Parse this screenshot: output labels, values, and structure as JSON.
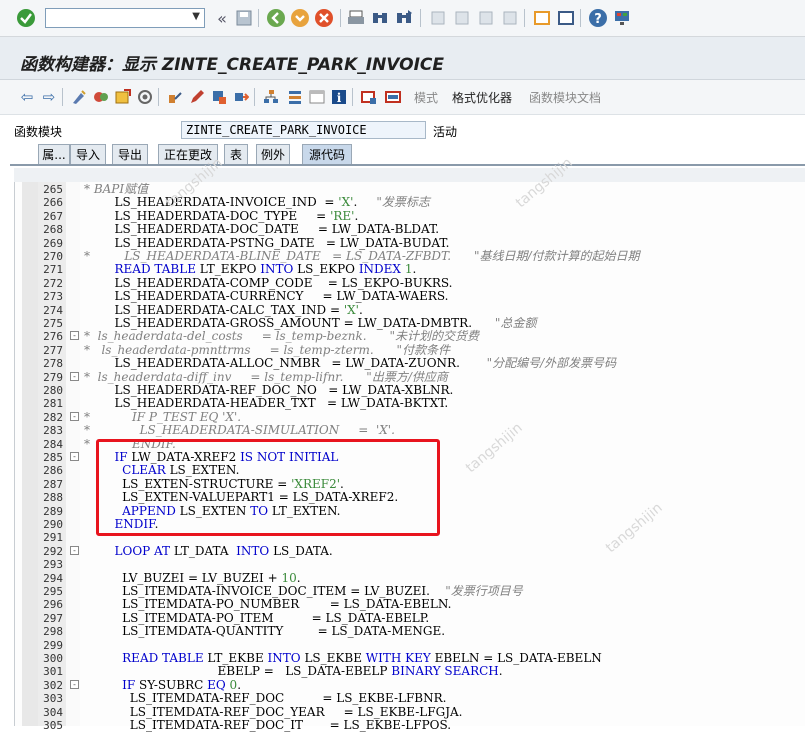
{
  "window": {
    "title": "函数构建器：显示 ZINTE_CREATE_PARK_INVOICE"
  },
  "toolbar2": {
    "mode_label": "模式",
    "pretty_printer_label": "格式优化器",
    "module_doc_label": "函数模块文档"
  },
  "function_module": {
    "label": "函数模块",
    "value": "ZINTE_CREATE_PARK_INVOICE",
    "status": "活动"
  },
  "tabs": [
    {
      "label": "属..."
    },
    {
      "label": "导入"
    },
    {
      "label": "导出"
    },
    {
      "label": "正在更改"
    },
    {
      "label": "表"
    },
    {
      "label": "例外"
    },
    {
      "label": "源代码"
    }
  ],
  "watermark": "tangshijin",
  "code_lines": [
    {
      "n": "265",
      "segs": [
        [
          "cm",
          "* BAPI赋值"
        ]
      ]
    },
    {
      "n": "266",
      "segs": [
        [
          "",
          "        LS_HEADERDATA-INVOICE_IND  = "
        ],
        [
          "str",
          "'X'"
        ],
        [
          "",
          "."
        ],
        [
          "cm",
          "     \"发票标志"
        ]
      ]
    },
    {
      "n": "267",
      "segs": [
        [
          "",
          "        LS_HEADERDATA-DOC_TYPE     = "
        ],
        [
          "str",
          "'RE'"
        ],
        [
          "",
          "."
        ]
      ]
    },
    {
      "n": "268",
      "segs": [
        [
          "",
          "        LS_HEADERDATA-DOC_DATE     = LW_DATA-BLDAT."
        ]
      ]
    },
    {
      "n": "269",
      "segs": [
        [
          "",
          "        LS_HEADERDATA-PSTNG_DATE   = LW_DATA-BUDAT."
        ]
      ]
    },
    {
      "n": "270",
      "segs": [
        [
          "cm",
          "*         LS_HEADERDATA-BLINE_DATE   = LS_DATA-ZFBDT.      \"基线日期/付款计算的起始日期"
        ]
      ]
    },
    {
      "n": "271",
      "segs": [
        [
          "kw",
          "        READ TABLE"
        ],
        [
          "",
          " LT_EKPO "
        ],
        [
          "kw",
          "INTO"
        ],
        [
          "",
          " LS_EKPO "
        ],
        [
          "kw",
          "INDEX"
        ],
        [
          "",
          " "
        ],
        [
          "num",
          "1"
        ],
        [
          "",
          "."
        ]
      ]
    },
    {
      "n": "272",
      "segs": [
        [
          "",
          "        LS_HEADERDATA-COMP_CODE    = LS_EKPO-BUKRS."
        ]
      ]
    },
    {
      "n": "273",
      "segs": [
        [
          "",
          "        LS_HEADERDATA-CURRENCY     = LW_DATA-WAERS."
        ]
      ]
    },
    {
      "n": "274",
      "segs": [
        [
          "",
          "        LS_HEADERDATA-CALC_TAX_IND = "
        ],
        [
          "str",
          "'X'"
        ],
        [
          "",
          "."
        ]
      ]
    },
    {
      "n": "275",
      "segs": [
        [
          "",
          "        LS_HEADERDATA-GROSS_AMOUNT = LW_DATA-DMBTR."
        ],
        [
          "cm",
          "      \"总金额"
        ]
      ]
    },
    {
      "n": "276",
      "fold": "-",
      "segs": [
        [
          "cm",
          "*  ls_headerdata-del_costs     = ls_temp-beznk.      \"未计划的交货费"
        ]
      ]
    },
    {
      "n": "277",
      "segs": [
        [
          "cm",
          "*   ls_headerdata-pmnttrms     = ls_temp-zterm.      \"付款条件"
        ]
      ]
    },
    {
      "n": "278",
      "segs": [
        [
          "",
          "        LS_HEADERDATA-ALLOC_NMBR   = LW_DATA-ZUONR."
        ],
        [
          "cm",
          "       \"分配编号/外部发票号码"
        ]
      ]
    },
    {
      "n": "279",
      "fold": "-",
      "segs": [
        [
          "cm",
          "*  ls_headerdata-diff_inv     = ls_temp-lifnr.      \"出票方/供应商"
        ]
      ]
    },
    {
      "n": "280",
      "segs": [
        [
          "",
          "        LS_HEADERDATA-REF_DOC_NO   = LW_DATA-XBLNR."
        ]
      ]
    },
    {
      "n": "281",
      "segs": [
        [
          "",
          "        LS_HEADERDATA-HEADER_TXT   = LW_DATA-BKTXT."
        ]
      ]
    },
    {
      "n": "282",
      "fold": "-",
      "segs": [
        [
          "cm",
          "*           IF P_TEST EQ 'X'."
        ]
      ]
    },
    {
      "n": "283",
      "segs": [
        [
          "cm",
          "*             LS_HEADERDATA-SIMULATION     =  'X'."
        ]
      ]
    },
    {
      "n": "284",
      "segs": [
        [
          "cm",
          "*           ENDIF."
        ]
      ]
    },
    {
      "n": "285",
      "fold": "-",
      "segs": [
        [
          "kw",
          "        IF"
        ],
        [
          "",
          " LW_DATA-XREF2 "
        ],
        [
          "kw",
          "IS NOT INITIAL"
        ],
        [
          "",
          ""
        ]
      ]
    },
    {
      "n": "286",
      "segs": [
        [
          "kw",
          "          CLEAR"
        ],
        [
          "",
          " LS_EXTEN."
        ]
      ]
    },
    {
      "n": "287",
      "segs": [
        [
          "",
          "          LS_EXTEN-STRUCTURE = "
        ],
        [
          "str",
          "'XREF2'"
        ],
        [
          "",
          "."
        ]
      ]
    },
    {
      "n": "288",
      "segs": [
        [
          "",
          "          LS_EXTEN-VALUEPART1 = LS_DATA-XREF2."
        ]
      ]
    },
    {
      "n": "289",
      "segs": [
        [
          "kw",
          "          APPEND"
        ],
        [
          "",
          " LS_EXTEN "
        ],
        [
          "kw",
          "TO"
        ],
        [
          "",
          " LT_EXTEN."
        ]
      ]
    },
    {
      "n": "290",
      "segs": [
        [
          "kw",
          "        ENDIF"
        ],
        [
          "",
          "."
        ]
      ]
    },
    {
      "n": "291",
      "segs": [
        [
          "",
          ""
        ]
      ]
    },
    {
      "n": "292",
      "fold": "-",
      "segs": [
        [
          "kw",
          "        LOOP AT"
        ],
        [
          "",
          " LT_DATA  "
        ],
        [
          "kw",
          "INTO"
        ],
        [
          "",
          " LS_DATA."
        ]
      ]
    },
    {
      "n": "293",
      "segs": [
        [
          "",
          ""
        ]
      ]
    },
    {
      "n": "294",
      "segs": [
        [
          "",
          "          LV_BUZEI = LV_BUZEI + "
        ],
        [
          "num",
          "10"
        ],
        [
          "",
          "."
        ]
      ]
    },
    {
      "n": "295",
      "segs": [
        [
          "",
          "          LS_ITEMDATA-INVOICE_DOC_ITEM = LV_BUZEI."
        ],
        [
          "cm",
          "    \"发票行项目号"
        ]
      ]
    },
    {
      "n": "296",
      "segs": [
        [
          "",
          "          LS_ITEMDATA-PO_NUMBER        = LS_DATA-EBELN."
        ]
      ]
    },
    {
      "n": "297",
      "segs": [
        [
          "",
          "          LS_ITEMDATA-PO_ITEM          = LS_DATA-EBELP."
        ]
      ]
    },
    {
      "n": "298",
      "segs": [
        [
          "",
          "          LS_ITEMDATA-QUANTITY         = LS_DATA-MENGE."
        ]
      ]
    },
    {
      "n": "299",
      "segs": [
        [
          "",
          ""
        ]
      ]
    },
    {
      "n": "300",
      "segs": [
        [
          "kw",
          "          READ TABLE"
        ],
        [
          "",
          " LT_EKBE "
        ],
        [
          "kw",
          "INTO"
        ],
        [
          "",
          " LS_EKBE "
        ],
        [
          "kw",
          "WITH KEY"
        ],
        [
          "",
          " EBELN = LS_DATA-EBELN"
        ]
      ]
    },
    {
      "n": "301",
      "segs": [
        [
          "",
          "                                   EBELP =   LS_DATA-EBELP "
        ],
        [
          "kw",
          "BINARY SEARCH"
        ],
        [
          "",
          "."
        ]
      ]
    },
    {
      "n": "302",
      "fold": "-",
      "segs": [
        [
          "kw",
          "          IF"
        ],
        [
          "",
          " SY-SUBRC "
        ],
        [
          "kw",
          "EQ"
        ],
        [
          "",
          " "
        ],
        [
          "num",
          "0"
        ],
        [
          "",
          "."
        ]
      ]
    },
    {
      "n": "303",
      "segs": [
        [
          "",
          "            LS_ITEMDATA-REF_DOC          = LS_EKBE-LFBNR."
        ]
      ]
    },
    {
      "n": "304",
      "segs": [
        [
          "",
          "            LS_ITEMDATA-REF_DOC_YEAR     = LS_EKBE-LFGJA."
        ]
      ]
    },
    {
      "n": "305",
      "segs": [
        [
          "",
          "            LS_ITEMDATA-REF_DOC_IT       = LS_EKBE-LFPOS."
        ]
      ]
    }
  ]
}
